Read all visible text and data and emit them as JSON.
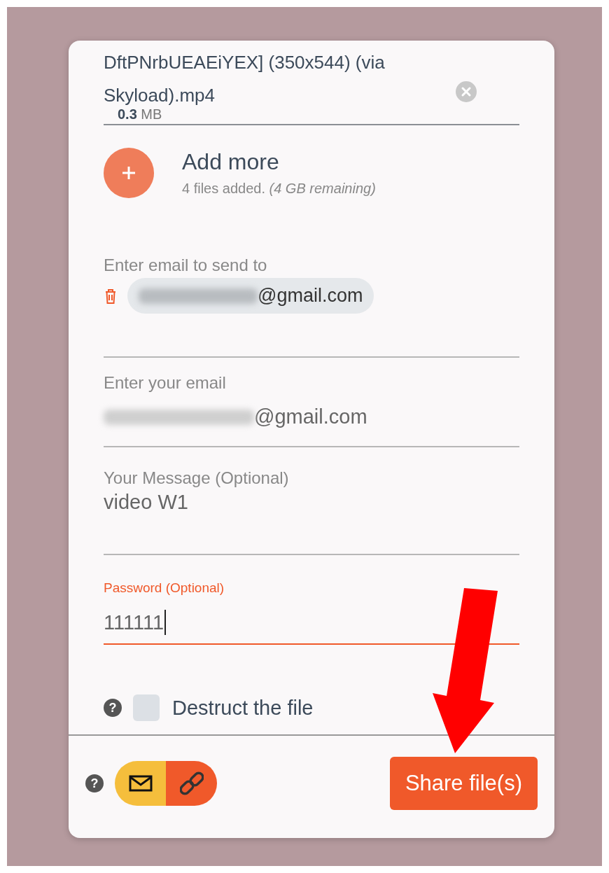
{
  "file": {
    "name": "DftPNrbUEAEiYEX] (350x544) (via Skyload).mp4",
    "size": "**0.3** MB"
  },
  "add_more": {
    "label": "Add more",
    "status": "4 files added. *(4 GB remaining)*"
  },
  "fields": [
    {
      "kind": "recipients",
      "label": "Enter email to send to",
      "value": "@gmail.com",
      "focused": false
    },
    {
      "kind": "text",
      "label": "Enter your email",
      "value": "@gmail.com",
      "focused": false
    },
    {
      "kind": "textarea",
      "label": "Your Message (Optional)",
      "value": "video W1",
      "focused": false
    },
    {
      "kind": "text",
      "label": "Password (Optional)",
      "value": "111111",
      "focused": true
    }
  ],
  "destruct": {
    "help": "?",
    "label": "Destruct the file",
    "checked": false
  },
  "footer_help": "?",
  "share_modes": [
    {
      "kind": "email",
      "selected": true
    },
    {
      "kind": "link",
      "selected": false
    }
  ],
  "share_button": "Share file(s)"
}
